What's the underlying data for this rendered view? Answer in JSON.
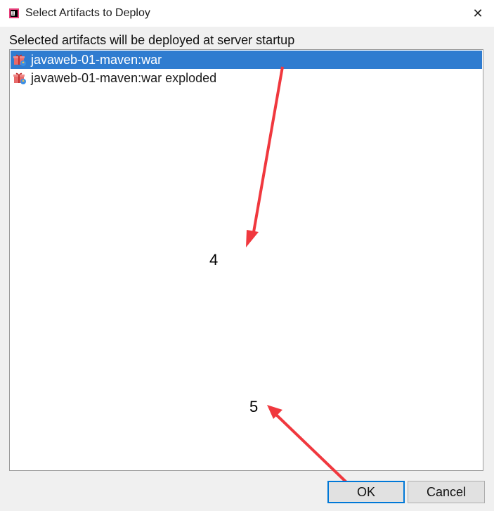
{
  "window": {
    "title": "Select Artifacts to Deploy",
    "close_glyph": "✕"
  },
  "caption": "Selected artifacts will be deployed at server startup",
  "artifacts": [
    {
      "label": "javaweb-01-maven:war",
      "selected": true,
      "icon": "artifact-icon"
    },
    {
      "label": "javaweb-01-maven:war exploded",
      "selected": false,
      "icon": "artifact-icon"
    }
  ],
  "annotations": {
    "step4": "4",
    "step5": "5"
  },
  "buttons": {
    "ok": "OK",
    "cancel": "Cancel"
  },
  "colors": {
    "selection": "#2f7cd0",
    "ok_border": "#0078d7",
    "arrow": "#f0383e"
  }
}
